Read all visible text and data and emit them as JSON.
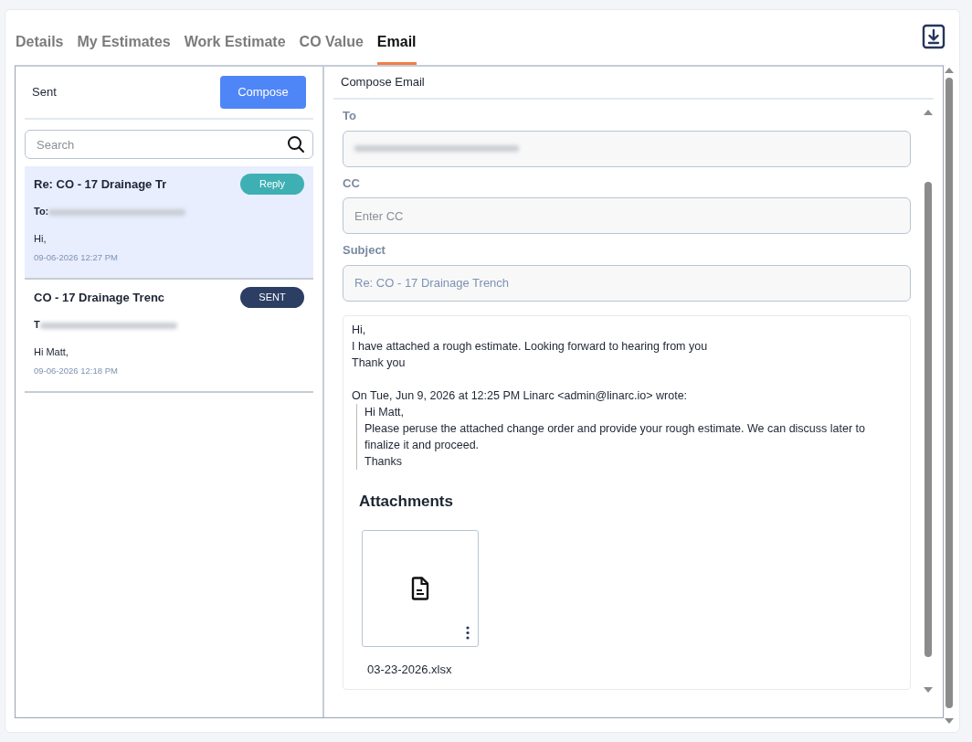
{
  "tabs": [
    {
      "label": "Details",
      "selected": false
    },
    {
      "label": "My Estimates",
      "selected": false
    },
    {
      "label": "Work Estimate",
      "selected": false
    },
    {
      "label": "CO Value",
      "selected": false
    },
    {
      "label": "Email",
      "selected": true
    }
  ],
  "sent_panel": {
    "title": "Sent",
    "compose_button": "Compose",
    "search": {
      "placeholder": "Search"
    },
    "emails": [
      {
        "subject": "Re: CO - 17 Drainage Tr",
        "to_label": "To:",
        "preview": "Hi,",
        "time": "09-06-2026 12:27 PM",
        "status": "Reply",
        "kind": "reply",
        "selected": true
      },
      {
        "subject": "CO - 17 Drainage Trenc",
        "to_label": "T",
        "preview": "Hi Matt,",
        "time": "09-06-2026 12:18 PM",
        "status": "SENT",
        "kind": "sent",
        "selected": false
      }
    ]
  },
  "compose": {
    "title": "Compose Email",
    "fields": [
      {
        "label": "To",
        "kind": "redacted"
      },
      {
        "label": "CC",
        "kind": "input",
        "placeholder": "Enter CC"
      },
      {
        "label": "Subject",
        "kind": "input",
        "value": "Re: CO - 17 Drainage Trench"
      }
    ],
    "body": {
      "lines": [
        "Hi,",
        "I have attached a rough estimate. Looking forward to hearing from you",
        "Thank you"
      ],
      "quote_header": "On Tue, Jun 9, 2026 at 12:25 PM Linarc <admin@linarc.io> wrote:",
      "quote_lines": [
        "Hi Matt,",
        "Please peruse the attached change order and provide your rough estimate. We can discuss later to finalize it and proceed.",
        "Thanks"
      ]
    },
    "attachments_title": "Attachments",
    "attachments": [
      {
        "name": "03-23-2026.xlsx"
      }
    ]
  }
}
